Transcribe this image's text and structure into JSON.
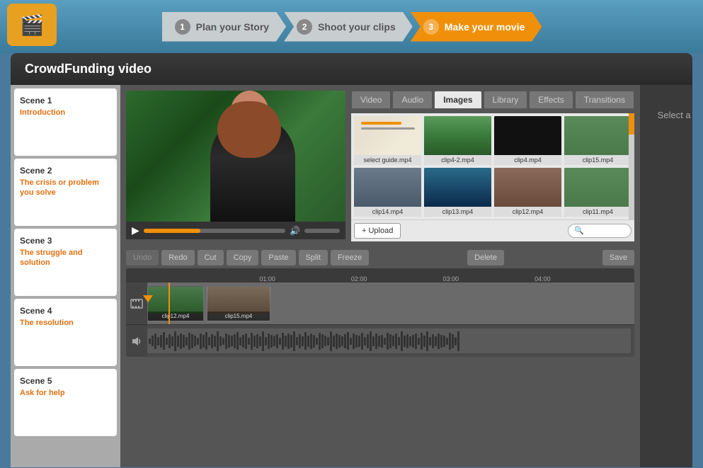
{
  "app": {
    "title": "CrowdFunding video",
    "logo": "🎬"
  },
  "steps": [
    {
      "num": "1",
      "label": "Plan your Story",
      "state": "inactive"
    },
    {
      "num": "2",
      "label": "Shoot your clips",
      "state": "inactive"
    },
    {
      "num": "3",
      "label": "Make your movie",
      "state": "active"
    }
  ],
  "scenes": [
    {
      "num": "Scene 1",
      "label": "Introduction"
    },
    {
      "num": "Scene 2",
      "label": "The crisis or problem you solve"
    },
    {
      "num": "Scene 3",
      "label": "The struggle and solution"
    },
    {
      "num": "Scene 4",
      "label": "The resolution"
    },
    {
      "num": "Scene 5",
      "label": "Ask for help"
    }
  ],
  "media_tabs": [
    "Video",
    "Audio",
    "Images",
    "Library",
    "Effects",
    "Transitions"
  ],
  "active_media_tab": "Images",
  "media_items": [
    {
      "label": "select guide.mp4",
      "thumb": "screenshot"
    },
    {
      "label": "clip4-2.mp4",
      "thumb": "person1"
    },
    {
      "label": "clip4.mp4",
      "thumb": "black"
    },
    {
      "label": "clip15.mp4",
      "thumb": "outdoor1"
    },
    {
      "label": "clip14.mp4",
      "thumb": "outdoor2"
    },
    {
      "label": "clip13.mp4",
      "thumb": "person2"
    },
    {
      "label": "clip12.mp4",
      "thumb": "indoor"
    },
    {
      "label": "clip11.mp4",
      "thumb": "outdoor1"
    }
  ],
  "toolbar": {
    "undo": "Undo",
    "redo": "Redo",
    "cut": "Cut",
    "copy": "Copy",
    "paste": "Paste",
    "split": "Split",
    "freeze": "Freeze",
    "delete": "Delete",
    "save": "Save"
  },
  "timeline": {
    "marks": [
      "01:00",
      "02:00",
      "03:00",
      "04:00"
    ],
    "clips": [
      {
        "label": "clip12.mp4"
      },
      {
        "label": "clip15.mp4"
      }
    ]
  },
  "right_panel": {
    "text": "Select a clip to edit properties"
  },
  "upload_btn": "+ Upload",
  "search_placeholder": "🔍"
}
